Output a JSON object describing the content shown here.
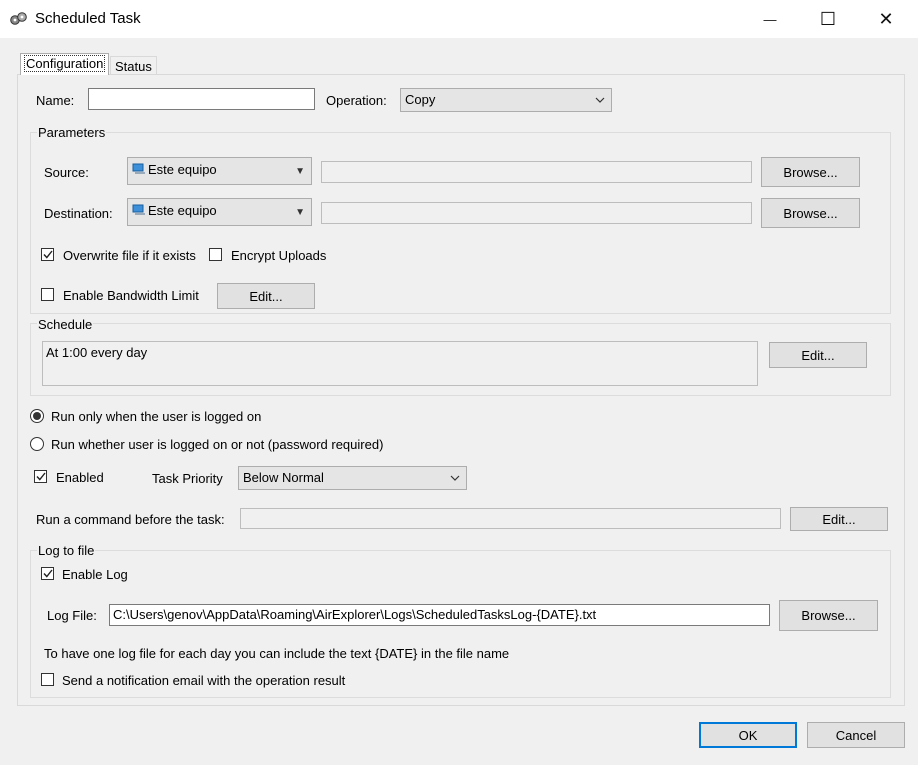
{
  "window": {
    "title": "Scheduled Task",
    "close_glyph": "✕",
    "max_glyph": "☐",
    "min_glyph": "—"
  },
  "tabs": [
    {
      "label": "Configuration"
    },
    {
      "label": "Status"
    }
  ],
  "config": {
    "name_label": "Name:",
    "name_value": "",
    "operation_label": "Operation:",
    "operation_value": "Copy"
  },
  "parameters": {
    "title": "Parameters",
    "source_label": "Source:",
    "source_value": "Este equipo",
    "source_path": "",
    "destination_label": "Destination:",
    "destination_value": "Este equipo",
    "destination_path": "",
    "browse_label": "Browse...",
    "overwrite_label": "Overwrite file if it exists",
    "overwrite_checked": true,
    "encrypt_label": "Encrypt Uploads",
    "encrypt_checked": false,
    "bandwidth_label": "Enable Bandwidth Limit",
    "bandwidth_checked": false,
    "edit_label": "Edit..."
  },
  "schedule": {
    "title": "Schedule",
    "text": "At 1:00 every day",
    "edit_label": "Edit..."
  },
  "run_options": {
    "logged_on_label": "Run only when the user is logged on",
    "always_label": "Run whether user is logged on or not (password required)",
    "selected": "logged_on"
  },
  "enabled": {
    "label": "Enabled",
    "checked": true
  },
  "priority": {
    "label": "Task Priority",
    "value": "Below Normal"
  },
  "command": {
    "label": "Run a command before the task:",
    "value": "",
    "edit_label": "Edit..."
  },
  "log": {
    "title": "Log to file",
    "enable_label": "Enable Log",
    "enable_checked": true,
    "file_label": "Log File:",
    "file_value": "C:\\Users\\genov\\AppData\\Roaming\\AirExplorer\\Logs\\ScheduledTasksLog-{DATE}.txt",
    "browse_label": "Browse...",
    "hint": "To have one log file for each day you can include the text {DATE} in the file name",
    "notify_label": "Send a notification email with the operation result",
    "notify_checked": false
  },
  "footer": {
    "ok_label": "OK",
    "cancel_label": "Cancel"
  },
  "colors": {
    "accent": "#0078d7",
    "panel": "#f0f0f0",
    "button": "#e1e1e1"
  }
}
